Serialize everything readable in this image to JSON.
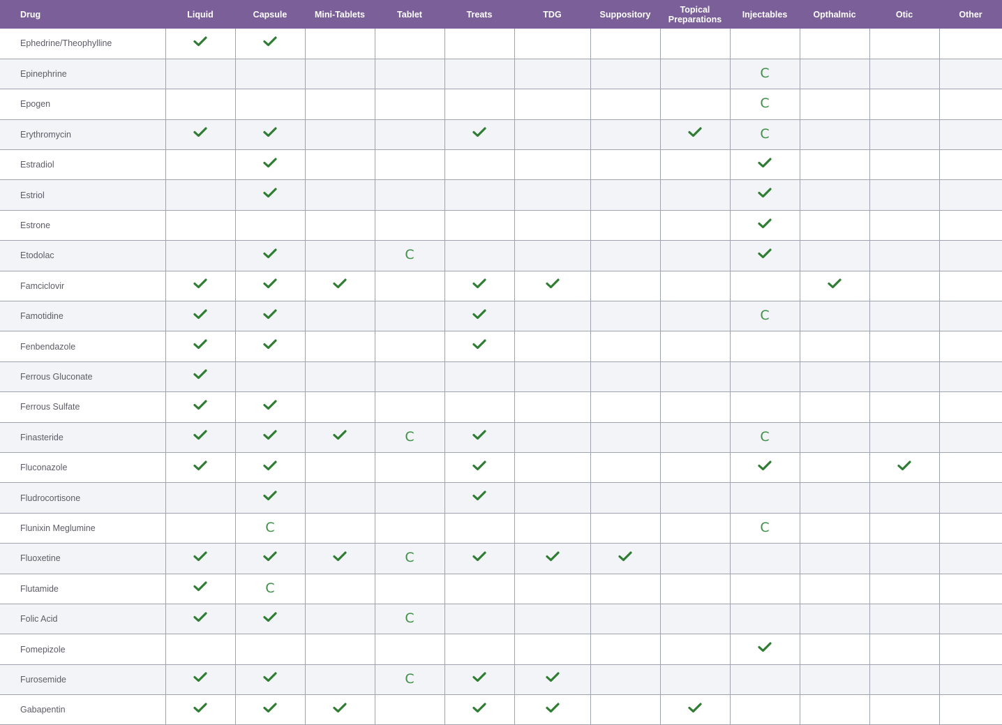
{
  "colors": {
    "header_bg": "#7b5f99",
    "check": "#2e7d32",
    "c_mark": "#3f8f48",
    "alt_row": "#f3f4f7",
    "grid": "#9ea3ad"
  },
  "icons": {
    "check": "check-icon",
    "compound": "letter-C"
  },
  "legend_values": {
    "Y": "available (check mark)",
    "C": "C",
    "": "empty"
  },
  "table": {
    "headers": [
      "Drug",
      "Liquid",
      "Capsule",
      "Mini-Tablets",
      "Tablet",
      "Treats",
      "TDG",
      "Suppository",
      "Topical Preparations",
      "Injectables",
      "Opthalmic",
      "Otic",
      "Other"
    ],
    "rows": [
      {
        "drug": "Ephedrine/Theophylline",
        "cells": [
          "Y",
          "Y",
          "",
          "",
          "",
          "",
          "",
          "",
          "",
          "",
          "",
          ""
        ]
      },
      {
        "drug": "Epinephrine",
        "cells": [
          "",
          "",
          "",
          "",
          "",
          "",
          "",
          "",
          "C",
          "",
          "",
          ""
        ]
      },
      {
        "drug": "Epogen",
        "cells": [
          "",
          "",
          "",
          "",
          "",
          "",
          "",
          "",
          "C",
          "",
          "",
          ""
        ]
      },
      {
        "drug": "Erythromycin",
        "cells": [
          "Y",
          "Y",
          "",
          "",
          "Y",
          "",
          "",
          "Y",
          "C",
          "",
          "",
          ""
        ]
      },
      {
        "drug": "Estradiol",
        "cells": [
          "",
          "Y",
          "",
          "",
          "",
          "",
          "",
          "",
          "Y",
          "",
          "",
          ""
        ]
      },
      {
        "drug": "Estriol",
        "cells": [
          "",
          "Y",
          "",
          "",
          "",
          "",
          "",
          "",
          "Y",
          "",
          "",
          ""
        ]
      },
      {
        "drug": "Estrone",
        "cells": [
          "",
          "",
          "",
          "",
          "",
          "",
          "",
          "",
          "Y",
          "",
          "",
          ""
        ]
      },
      {
        "drug": "Etodolac",
        "cells": [
          "",
          "Y",
          "",
          "C",
          "",
          "",
          "",
          "",
          "Y",
          "",
          "",
          ""
        ]
      },
      {
        "drug": "Famciclovir",
        "cells": [
          "Y",
          "Y",
          "Y",
          "",
          "Y",
          "Y",
          "",
          "",
          "",
          "Y",
          "",
          ""
        ]
      },
      {
        "drug": "Famotidine",
        "cells": [
          "Y",
          "Y",
          "",
          "",
          "Y",
          "",
          "",
          "",
          "C",
          "",
          "",
          ""
        ]
      },
      {
        "drug": "Fenbendazole",
        "cells": [
          "Y",
          "Y",
          "",
          "",
          "Y",
          "",
          "",
          "",
          "",
          "",
          "",
          ""
        ]
      },
      {
        "drug": "Ferrous Gluconate",
        "cells": [
          "Y",
          "",
          "",
          "",
          "",
          "",
          "",
          "",
          "",
          "",
          "",
          ""
        ]
      },
      {
        "drug": "Ferrous Sulfate",
        "cells": [
          "Y",
          "Y",
          "",
          "",
          "",
          "",
          "",
          "",
          "",
          "",
          "",
          ""
        ]
      },
      {
        "drug": "Finasteride",
        "cells": [
          "Y",
          "Y",
          "Y",
          "C",
          "Y",
          "",
          "",
          "",
          "C",
          "",
          "",
          ""
        ]
      },
      {
        "drug": "Fluconazole",
        "cells": [
          "Y",
          "Y",
          "",
          "",
          "Y",
          "",
          "",
          "",
          "Y",
          "",
          "Y",
          ""
        ]
      },
      {
        "drug": "Fludrocortisone",
        "cells": [
          "",
          "Y",
          "",
          "",
          "Y",
          "",
          "",
          "",
          "",
          "",
          "",
          ""
        ]
      },
      {
        "drug": "Flunixin Meglumine",
        "cells": [
          "",
          "C",
          "",
          "",
          "",
          "",
          "",
          "",
          "C",
          "",
          "",
          ""
        ]
      },
      {
        "drug": "Fluoxetine",
        "cells": [
          "Y",
          "Y",
          "Y",
          "C",
          "Y",
          "Y",
          "Y",
          "",
          "",
          "",
          "",
          ""
        ]
      },
      {
        "drug": "Flutamide",
        "cells": [
          "Y",
          "C",
          "",
          "",
          "",
          "",
          "",
          "",
          "",
          "",
          "",
          ""
        ]
      },
      {
        "drug": "Folic Acid",
        "cells": [
          "Y",
          "Y",
          "",
          "C",
          "",
          "",
          "",
          "",
          "",
          "",
          "",
          ""
        ]
      },
      {
        "drug": "Fomepizole",
        "cells": [
          "",
          "",
          "",
          "",
          "",
          "",
          "",
          "",
          "Y",
          "",
          "",
          ""
        ]
      },
      {
        "drug": "Furosemide",
        "cells": [
          "Y",
          "Y",
          "",
          "C",
          "Y",
          "Y",
          "",
          "",
          "",
          "",
          "",
          ""
        ]
      },
      {
        "drug": "Gabapentin",
        "cells": [
          "Y",
          "Y",
          "Y",
          "",
          "Y",
          "Y",
          "",
          "Y",
          "",
          "",
          "",
          ""
        ]
      }
    ]
  }
}
